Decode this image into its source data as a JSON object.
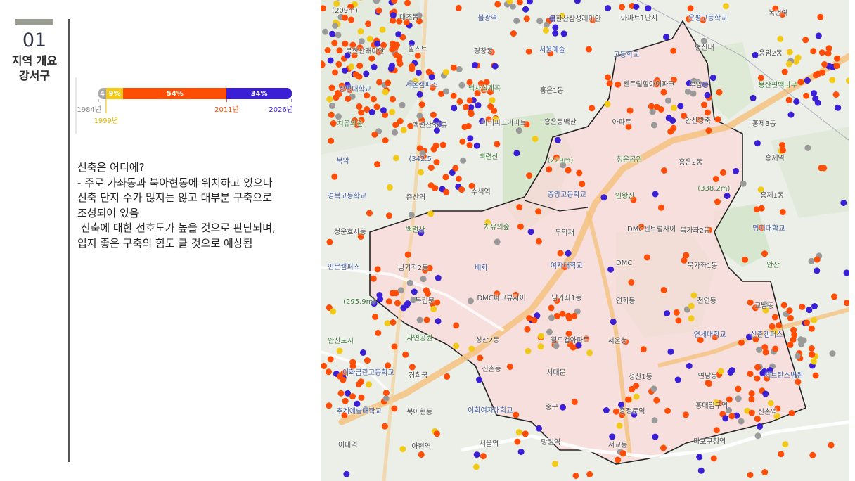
{
  "section": {
    "number": "01",
    "title_line1": "지역 개요",
    "title_line2": "강서구"
  },
  "chart_data": {
    "type": "bar",
    "categories": [
      "1984년",
      "1999년",
      "2011년",
      "2026년"
    ],
    "series": [
      {
        "values": [
          4,
          9,
          54,
          34
        ]
      }
    ],
    "value_labels": [
      "4",
      "9%",
      "54%",
      "34%"
    ],
    "colors": [
      "#a8a8a8",
      "#f2c916",
      "#ff4d06",
      "#3b1fd6"
    ]
  },
  "description": {
    "lines": [
      "신축은 어디에?",
      "- 주로 가좌동과 북아현동에 위치하고 있으나",
      "신축 단지 수가 많지는 않고 대부분 구축으로",
      "조성되어 있음",
      " 신축에 대한 선호도가 높을 것으로 판단되며,",
      "입지 좋은 구축의 힘도 클 것으로 예상됨"
    ]
  },
  "map": {
    "labels": [
      {
        "t": "(209m)",
        "c": ""
      },
      {
        "t": "대조동",
        "c": ""
      },
      {
        "t": "불광역",
        "c": "blue"
      },
      {
        "t": "북한산삼성래미안",
        "c": ""
      },
      {
        "t": "아파트1단지",
        "c": ""
      },
      {
        "t": "은평고등학교",
        "c": "blue"
      },
      {
        "t": "녹번역",
        "c": ""
      },
      {
        "t": "북한산래미안",
        "c": ""
      },
      {
        "t": "힐즈트",
        "c": ""
      },
      {
        "t": "평창동",
        "c": ""
      },
      {
        "t": "서울예술",
        "c": "blue"
      },
      {
        "t": "고등학교",
        "c": "blue"
      },
      {
        "t": "연신내",
        "c": ""
      },
      {
        "t": "응암2동",
        "c": ""
      },
      {
        "t": "상명대학교",
        "c": "blue"
      },
      {
        "t": "서울캠퍼스",
        "c": "blue"
      },
      {
        "t": "백사실계곡",
        "c": "green"
      },
      {
        "t": "홍은1동",
        "c": ""
      },
      {
        "t": "센트럴힐아이파크",
        "c": ""
      },
      {
        "t": "부암동",
        "c": ""
      },
      {
        "t": "봉산편백나무",
        "c": "green"
      },
      {
        "t": "치유의숲",
        "c": "green"
      },
      {
        "t": "백련산SK뷰",
        "c": ""
      },
      {
        "t": "아이파크아파트",
        "c": ""
      },
      {
        "t": "홍은동백산",
        "c": ""
      },
      {
        "t": "아파트",
        "c": ""
      },
      {
        "t": "안산방죽",
        "c": ""
      },
      {
        "t": "홍제3동",
        "c": ""
      },
      {
        "t": "북악",
        "c": "blue"
      },
      {
        "t": "(342.5",
        "c": "blue"
      },
      {
        "t": "백련산",
        "c": "green"
      },
      {
        "t": "(229m)",
        "c": "green"
      },
      {
        "t": "청운공원",
        "c": "green"
      },
      {
        "t": "홍은2동",
        "c": ""
      },
      {
        "t": "홍제역",
        "c": ""
      },
      {
        "t": "경복고등학교",
        "c": "blue"
      },
      {
        "t": "증산역",
        "c": ""
      },
      {
        "t": "수색역",
        "c": ""
      },
      {
        "t": "중앙고등학교",
        "c": "blue"
      },
      {
        "t": "인왕산",
        "c": "green"
      },
      {
        "t": "(338.2m)",
        "c": "green"
      },
      {
        "t": "홍제1동",
        "c": ""
      },
      {
        "t": "청운효자동",
        "c": ""
      },
      {
        "t": "백련산",
        "c": "green"
      },
      {
        "t": "치유의숲",
        "c": "green"
      },
      {
        "t": "무악재",
        "c": ""
      },
      {
        "t": "DMC센트럴자이",
        "c": ""
      },
      {
        "t": "북가좌2동",
        "c": ""
      },
      {
        "t": "명지대학교",
        "c": "blue"
      },
      {
        "t": "인문캠퍼스",
        "c": "blue"
      },
      {
        "t": "남가좌2동",
        "c": ""
      },
      {
        "t": "배화",
        "c": "blue"
      },
      {
        "t": "여자대학교",
        "c": "blue"
      },
      {
        "t": "DMC",
        "c": ""
      },
      {
        "t": "북가좌1동",
        "c": ""
      },
      {
        "t": "안산",
        "c": "green"
      },
      {
        "t": "(295.9m)",
        "c": "green"
      },
      {
        "t": "독립문",
        "c": ""
      },
      {
        "t": "DMC파크뷰자이",
        "c": ""
      },
      {
        "t": "남가좌1동",
        "c": ""
      },
      {
        "t": "연희동",
        "c": ""
      },
      {
        "t": "천연동",
        "c": ""
      },
      {
        "t": "교남동",
        "c": ""
      },
      {
        "t": "안산도시",
        "c": "green"
      },
      {
        "t": "자연공원",
        "c": "green"
      },
      {
        "t": "성산2동",
        "c": ""
      },
      {
        "t": "월드컵아파트",
        "c": ""
      },
      {
        "t": "서울청",
        "c": ""
      },
      {
        "t": "연세대학교",
        "c": "blue"
      },
      {
        "t": "신촌캠퍼스",
        "c": "blue"
      },
      {
        "t": "이화금란고등학교",
        "c": "blue"
      },
      {
        "t": "경희궁",
        "c": ""
      },
      {
        "t": "신촌동",
        "c": ""
      },
      {
        "t": "서대문",
        "c": ""
      },
      {
        "t": "성산1동",
        "c": ""
      },
      {
        "t": "연남동",
        "c": ""
      },
      {
        "t": "세브란스병원",
        "c": "blue"
      },
      {
        "t": "추계예술대학교",
        "c": "blue"
      },
      {
        "t": "북아현동",
        "c": ""
      },
      {
        "t": "이화여자대학교",
        "c": "blue"
      },
      {
        "t": "중구",
        "c": ""
      },
      {
        "t": "충정로역",
        "c": ""
      },
      {
        "t": "홍대입구역",
        "c": ""
      },
      {
        "t": "신촌역",
        "c": ""
      },
      {
        "t": "이대역",
        "c": ""
      },
      {
        "t": "아현역",
        "c": ""
      },
      {
        "t": "서울역",
        "c": ""
      },
      {
        "t": "망원역",
        "c": ""
      },
      {
        "t": "서교동",
        "c": ""
      },
      {
        "t": "마포구청역",
        "c": ""
      }
    ]
  }
}
